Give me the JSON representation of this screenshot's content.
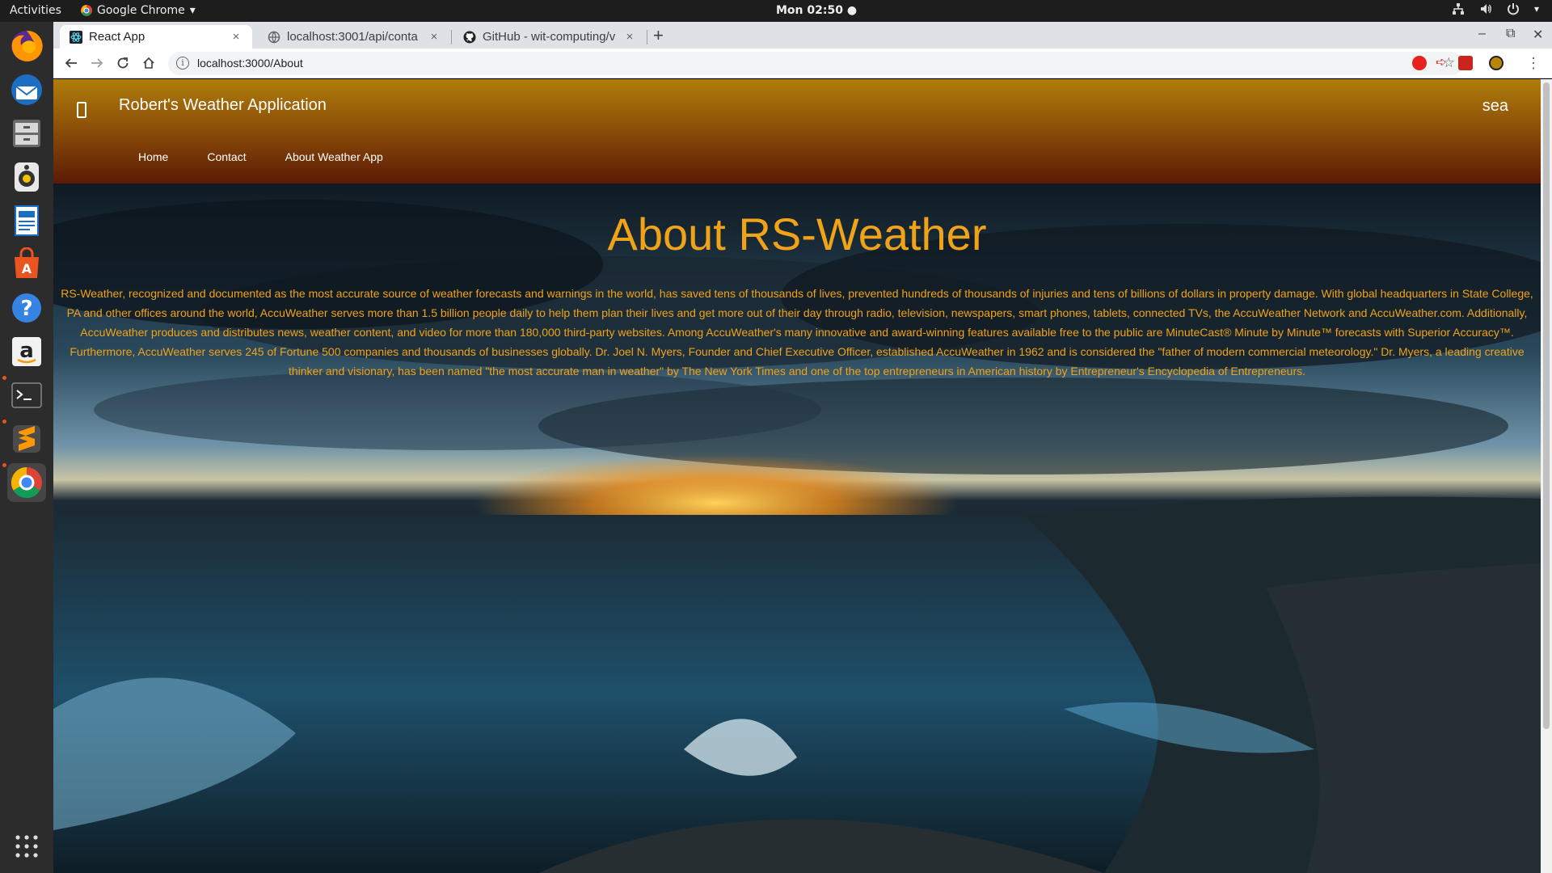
{
  "system": {
    "activities": "Activities",
    "app_menu": "Google Chrome",
    "clock": "Mon 02:50"
  },
  "browser": {
    "tabs": [
      {
        "title": "React App",
        "close": "×"
      },
      {
        "title": "localhost:3001/api/conta",
        "close": "×"
      },
      {
        "title": "GitHub - wit-computing/v",
        "close": "×"
      }
    ],
    "new_tab": "+",
    "url": "localhost:3000/About"
  },
  "app": {
    "brand": "Robert's Weather Application",
    "search_text": "sea",
    "nav": [
      "Home",
      "Contact",
      "About Weather App"
    ],
    "about_title": "About RS-Weather",
    "about_text": "RS-Weather, recognized and documented as the most accurate source of weather forecasts and warnings in the world, has saved tens of thousands of lives, prevented hundreds of thousands of injuries and tens of billions of dollars in property damage. With global headquarters in State College, PA and other offices around the world, AccuWeather serves more than 1.5 billion people daily to help them plan their lives and get more out of their day through radio, television, newspapers, smart phones, tablets, connected TVs, the AccuWeather Network and AccuWeather.com. Additionally, AccuWeather produces and distributes news, weather content, and video for more than 180,000 third-party websites. Among AccuWeather's many innovative and award-winning features available free to the public are MinuteCast® Minute by Minute™ forecasts with Superior Accuracy™. Furthermore, AccuWeather serves 245 of Fortune 500 companies and thousands of businesses globally. Dr. Joel N. Myers, Founder and Chief Executive Officer, established AccuWeather in 1962 and is considered the \"father of modern commercial meteorology.\" Dr. Myers, a leading creative thinker and visionary, has been named \"the most accurate man in weather\" by The New York Times and one of the top entrepreneurs in American history by Entrepreneur's Encyclopedia of Entrepreneurs."
  },
  "colors": {
    "accent": "#f0a319",
    "navbar_top": "#b07d0a",
    "navbar_bottom": "#5c1a06"
  }
}
